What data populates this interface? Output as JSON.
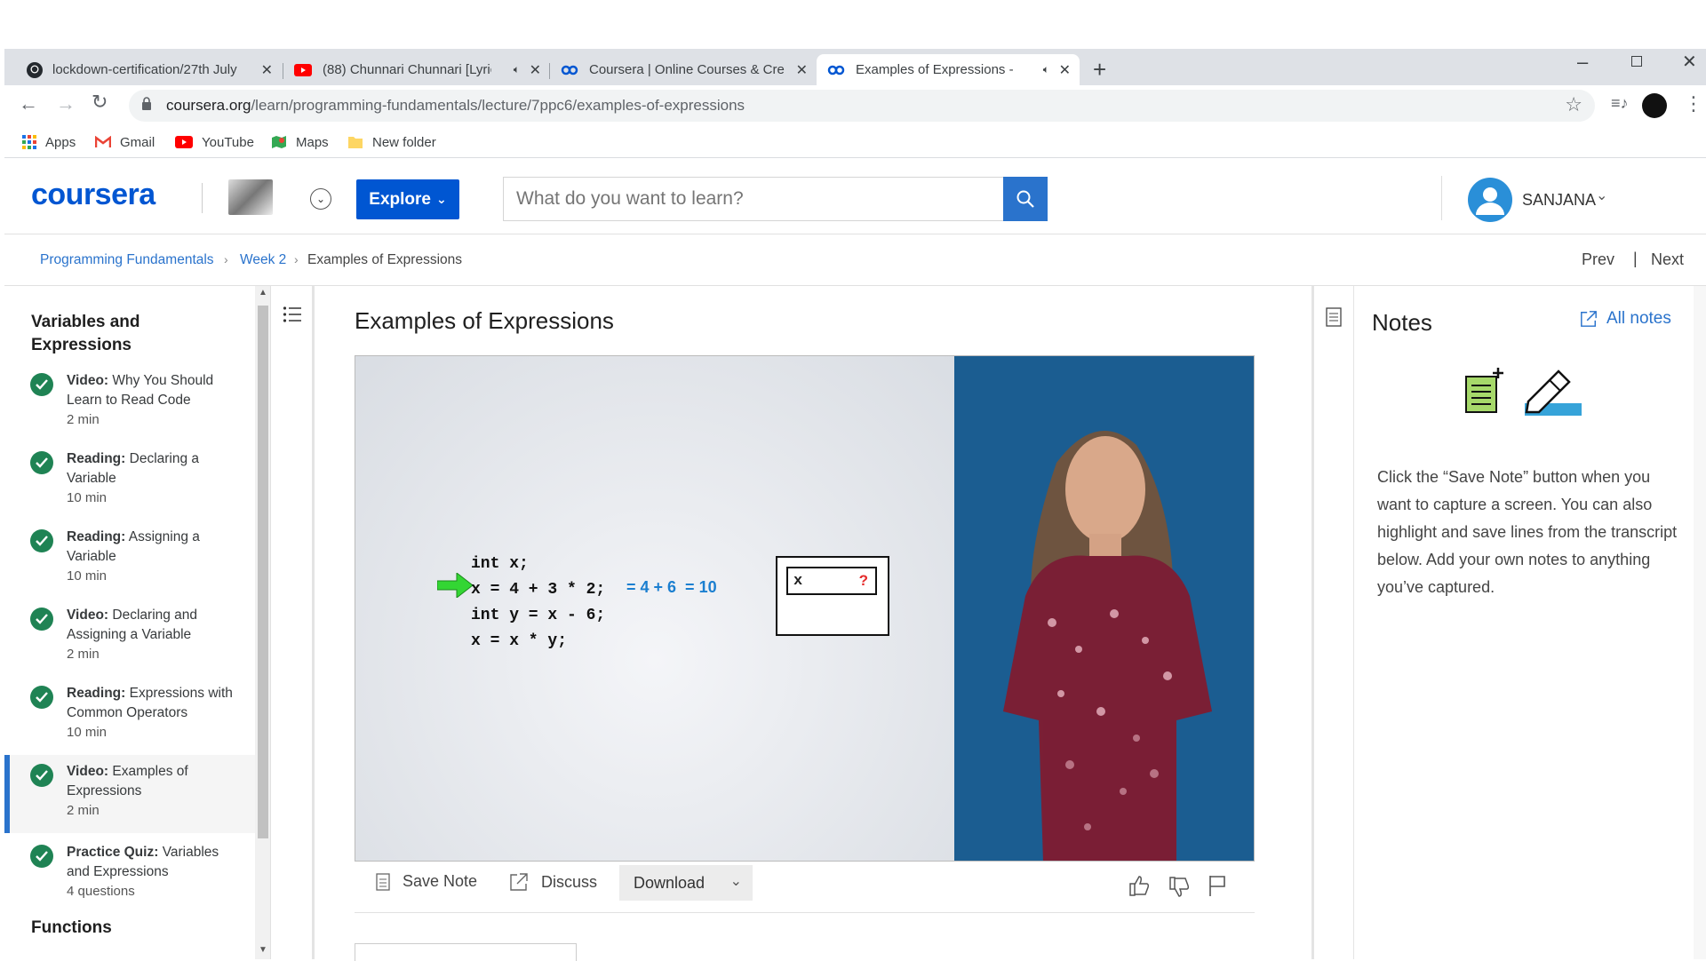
{
  "browser": {
    "tabs": [
      {
        "title": "lockdown-certification/27th July",
        "icon": "github-icon"
      },
      {
        "title": "(88) Chunnari Chunnari [Lyric",
        "icon": "youtube-icon"
      },
      {
        "title": "Coursera | Online Courses & Cre",
        "icon": "coursera-icon"
      },
      {
        "title": "Examples of Expressions - D",
        "icon": "coursera-icon"
      }
    ],
    "url_domain": "coursera.org",
    "url_path": "/learn/programming-fundamentals/lecture/7ppc6/examples-of-expressions",
    "bookmarks": [
      {
        "label": "Apps",
        "icon": "apps-grid-icon"
      },
      {
        "label": "Gmail",
        "icon": "gmail-icon"
      },
      {
        "label": "YouTube",
        "icon": "youtube-icon"
      },
      {
        "label": "Maps",
        "icon": "maps-icon"
      },
      {
        "label": "New folder",
        "icon": "folder-icon"
      }
    ]
  },
  "header": {
    "logo": "coursera",
    "explore_label": "Explore",
    "search_placeholder": "What do you want to learn?",
    "user_name": "SANJANA"
  },
  "breadcrumb": {
    "items": [
      "Programming Fundamentals",
      "Week 2",
      "Examples of Expressions"
    ],
    "prev": "Prev",
    "next": "Next"
  },
  "sidebar": {
    "section_title": "Variables and Expressions",
    "items": [
      {
        "type": "Video:",
        "title": "Why You Should Learn to Read Code",
        "duration": "2 min"
      },
      {
        "type": "Reading:",
        "title": "Declaring a Variable",
        "duration": "10 min"
      },
      {
        "type": "Reading:",
        "title": "Assigning a Variable",
        "duration": "10 min"
      },
      {
        "type": "Video:",
        "title": "Declaring and Assigning a Variable",
        "duration": "2 min"
      },
      {
        "type": "Reading:",
        "title": "Expressions with Common Operators",
        "duration": "10 min"
      },
      {
        "type": "Video:",
        "title": "Examples of Expressions",
        "duration": "2 min"
      },
      {
        "type": "Practice Quiz:",
        "title": "Variables and Expressions",
        "duration": "4 questions"
      }
    ],
    "next_section_title": "Functions"
  },
  "main": {
    "title": "Examples of Expressions",
    "code_lines": [
      "int x;",
      "x = 4 + 3 * 2;",
      "int y = x - 6;",
      "x = x * y;"
    ],
    "annotation": "= 4 + 6  = 10",
    "box_var": "x",
    "box_val": "?",
    "save_note": "Save Note",
    "discuss": "Discuss",
    "download": "Download"
  },
  "notes": {
    "title": "Notes",
    "all_notes": "All notes",
    "body": "Click the “Save Note” button when you want to capture a screen. You can also highlight and save lines from the transcript below. Add your own notes to anything you’ve captured."
  },
  "colors": {
    "accent": "#0056d2",
    "complete": "#1f8354",
    "active_bar": "#2a73cc",
    "video_blue": "#1b5d91"
  }
}
